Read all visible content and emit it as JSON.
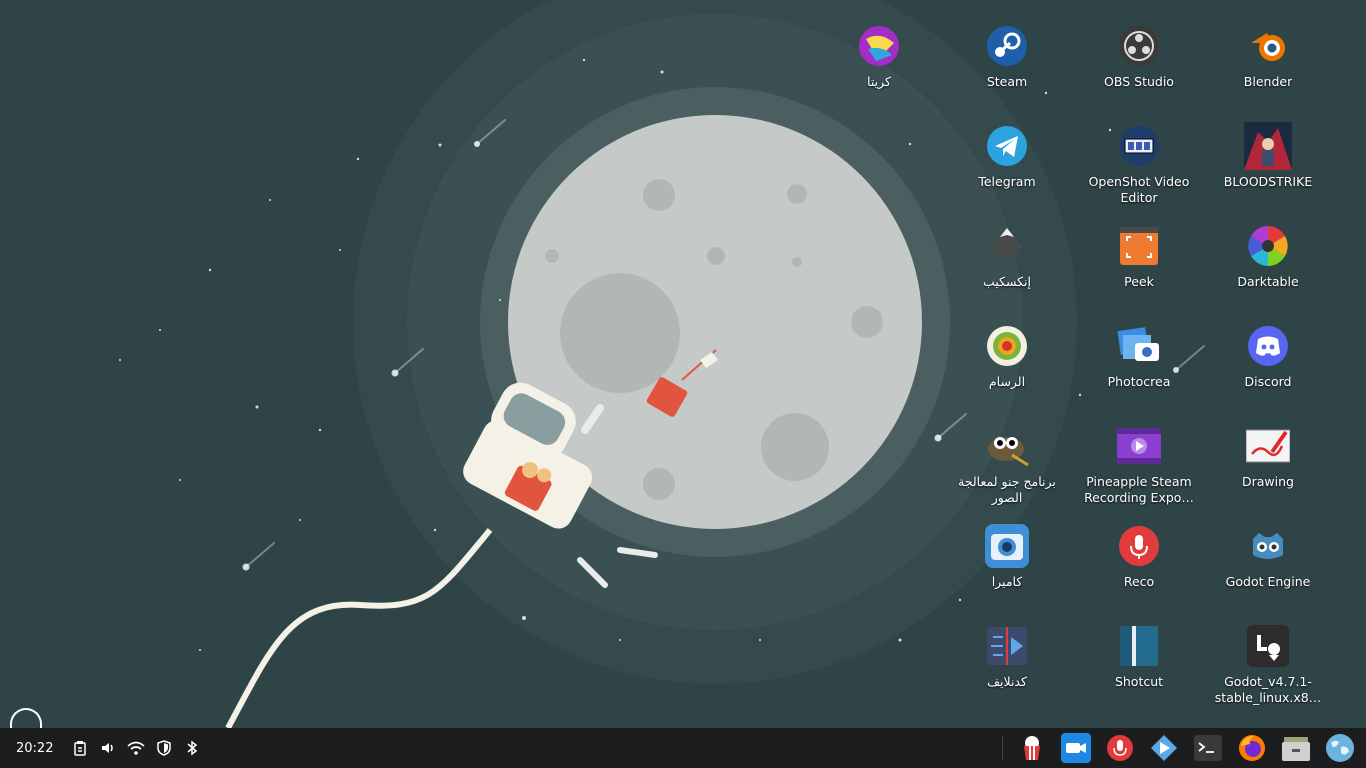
{
  "desktop": {
    "icons": [
      {
        "id": "krita",
        "label": "كريتا",
        "icon": "krita-icon"
      },
      {
        "id": "steam",
        "label": "Steam",
        "icon": "steam-icon"
      },
      {
        "id": "obs",
        "label": "OBS Studio",
        "icon": "obs-studio-icon"
      },
      {
        "id": "blender",
        "label": "Blender",
        "icon": "blender-icon"
      },
      {
        "id": "telegram",
        "label": "Telegram",
        "icon": "telegram-icon"
      },
      {
        "id": "openshot",
        "label": "OpenShot Video Editor",
        "icon": "openshot-icon"
      },
      {
        "id": "bloodstrike",
        "label": "BLOODSTRIKE",
        "icon": "bloodstrike-icon"
      },
      {
        "id": "inkscape",
        "label": "إنكسكيب",
        "icon": "inkscape-icon"
      },
      {
        "id": "peek",
        "label": "Peek",
        "icon": "peek-icon"
      },
      {
        "id": "darktable",
        "label": "Darktable",
        "icon": "darktable-icon"
      },
      {
        "id": "drawer",
        "label": "الرسام",
        "icon": "drawer-icon"
      },
      {
        "id": "photocrea",
        "label": "Photocrea",
        "icon": "photocrea-icon"
      },
      {
        "id": "discord",
        "label": "Discord",
        "icon": "discord-icon"
      },
      {
        "id": "gimp",
        "label": "برنامج جنو لمعالجة الصور",
        "icon": "gimp-icon"
      },
      {
        "id": "pineapple",
        "label": "Pineapple Steam Recording Expo…",
        "icon": "video-file-icon"
      },
      {
        "id": "drawing",
        "label": "Drawing",
        "icon": "drawing-icon"
      },
      {
        "id": "camera",
        "label": "كاميرا",
        "icon": "camera-icon"
      },
      {
        "id": "reco",
        "label": "Reco",
        "icon": "microphone-icon"
      },
      {
        "id": "godot",
        "label": "Godot Engine",
        "icon": "godot-icon"
      },
      {
        "id": "kdenlive",
        "label": "كدنلايف",
        "icon": "kdenlive-icon"
      },
      {
        "id": "shotcut",
        "label": "Shotcut",
        "icon": "shotcut-icon"
      },
      {
        "id": "godot-bin",
        "label": "Godot_v4.7.1-stable_linux.x8…",
        "icon": "executable-icon"
      }
    ]
  },
  "taskbar": {
    "clock": "20:22",
    "tray": [
      "clipboard-icon",
      "volume-icon",
      "wifi-icon",
      "shield-icon",
      "bluetooth-icon"
    ],
    "apps": [
      "popcorn-icon",
      "screen-recorder-icon",
      "microphone-icon",
      "kdenlive-icon",
      "terminal-icon",
      "firefox-icon",
      "file-manager-icon",
      "globe-icon"
    ]
  },
  "colors": {
    "wallpaper": "#2f4447",
    "taskbar": "#1b1d1e",
    "moon": "#c5cac9"
  }
}
